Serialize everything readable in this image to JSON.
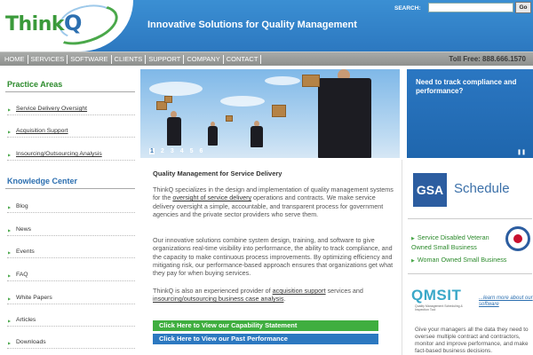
{
  "header": {
    "logo_text": "ThinkQ",
    "logo_text_main": "Think",
    "logo_text_q": "Q",
    "tagline": "Innovative Solutions for Quality Management",
    "search_label": "SEARCH:",
    "search_placeholder": "",
    "search_button": "Go"
  },
  "nav": {
    "items": [
      "HOME",
      "SERVICES",
      "SOFTWARE",
      "CLIENTS",
      "SUPPORT",
      "COMPANY",
      "CONTACT"
    ],
    "toll_free": "Toll Free: 888.666.1570"
  },
  "sidebar": {
    "practice_heading": "Practice Areas",
    "practice_items": [
      "Service Delivery Oversight",
      "Acquisition Support",
      "Insourcing/Outsourcing Analysis"
    ],
    "knowledge_heading": "Knowledge Center",
    "knowledge_items": [
      "Blog",
      "News",
      "Events",
      "FAQ",
      "White Papers",
      "Articles",
      "Downloads"
    ]
  },
  "banner": {
    "pager": [
      "1",
      "2",
      "3",
      "4",
      "5",
      "6"
    ],
    "active_page": 1
  },
  "promo": {
    "title": "Need to track compliance and performance?",
    "pause_icon": "pause-icon"
  },
  "main": {
    "heading": "Quality Management for Service Delivery",
    "p1_a": "ThinkQ specializes in the design and implementation of quality management systems for the ",
    "p1_link": "oversight of service delivery",
    "p1_b": " operations and contracts. We make service delivery oversight a simple, accountable, and transparent process for government agencies and the private sector providers who serve them.",
    "p2": "Our innovative solutions combine system design, training, and software to give organizations real-time visibility into performance, the ability to track compliance, and the capacity to make continuous process improvements. By optimizing efficiency and mitigating risk, our performance-based approach ensures that organizations get what they pay for when buying services.",
    "p3_a": "ThinkQ is also an experienced provider of ",
    "p3_link1": "acquisition support",
    "p3_b": " services and ",
    "p3_link2": "insourcing/outsourcing business case analysis",
    "p3_c": ".",
    "cta_capability": "Click Here to View our Capability Statement",
    "cta_performance": "Click Here to View our Past Performance"
  },
  "rightcol": {
    "gsa_logo": "GSA",
    "gsa_schedule": "Schedule",
    "sdvosb": "Service Disabled Veteran Owned Small Business",
    "wosb": "Woman Owned Small Business",
    "qmsit_word": "QMSIT",
    "qmsit_sub": "Quality Management Scheduling & Inspection Tool",
    "learn_more": "...learn more about our software",
    "desc": "Give your managers all the data they need to oversee multiple contract and contractors, monitor and improve performance, and make fact-based business decisions."
  },
  "colors": {
    "header_blue": "#2c78c0",
    "nav_gray": "#8e908e",
    "brand_green": "#3fae3f",
    "link_blue": "#2c6fb0"
  }
}
